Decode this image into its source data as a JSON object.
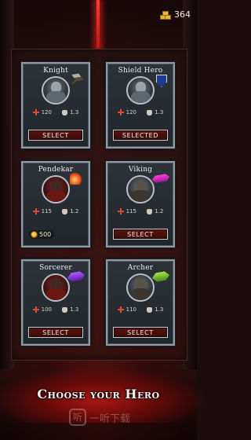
{
  "currency": {
    "icon": "gold-bars-icon",
    "amount": "364"
  },
  "heroes": [
    {
      "name": "Knight",
      "health": "120",
      "power": "1.3",
      "button": "SELECT",
      "weapon": "axe-icon"
    },
    {
      "name": "Shield Hero",
      "health": "120",
      "power": "1.3",
      "button": "SELECTED",
      "weapon": "shield-icon"
    },
    {
      "name": "Pendekar",
      "health": "115",
      "power": "1.2",
      "price": "500",
      "weapon": "fire-blade-icon"
    },
    {
      "name": "Viking",
      "health": "115",
      "power": "1.2",
      "button": "SELECT",
      "weapon": "magenta-axe-icon"
    },
    {
      "name": "Sorcerer",
      "health": "100",
      "power": "1.3",
      "button": "SELECT",
      "weapon": "purple-blade-icon"
    },
    {
      "name": "Archer",
      "health": "110",
      "power": "1.3",
      "button": "SELECT",
      "weapon": "green-arrow-icon"
    }
  ],
  "title": "Choose your Hero",
  "watermark": {
    "icon": "watermark-logo-icon",
    "glyph": "听",
    "text": "一听下载"
  },
  "colors": {
    "accent": "#5a1410",
    "laser": "#ff3b2f",
    "card_border": "#8f9aa2",
    "gold": "#e7b93a"
  }
}
